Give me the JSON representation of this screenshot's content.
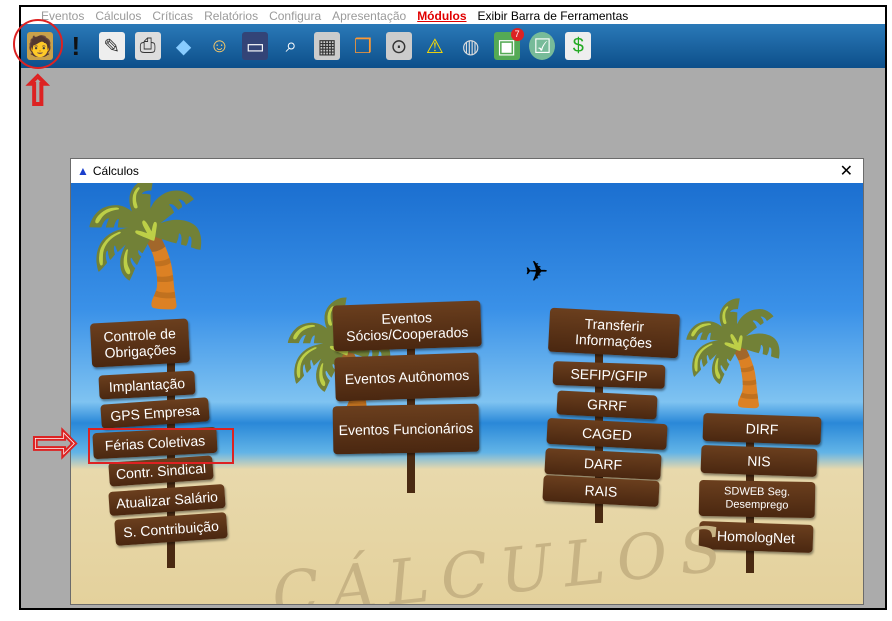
{
  "menu": {
    "items": [
      "Eventos",
      "Cálculos",
      "Críticas",
      "Relatórios",
      "Configura",
      "Apresentação"
    ],
    "active": "Módulos",
    "extra": "Exibir Barra de Ferramentas"
  },
  "toolbar": {
    "icons": [
      "person-desk-icon",
      "exclamation-icon",
      "pen-icon",
      "printer-icon",
      "paint-bucket-icon",
      "users-key-icon",
      "monitor-icon",
      "magnifier-icon",
      "calculator-icon",
      "book-icon",
      "search-doc-icon",
      "warning-icon",
      "database-icon",
      "calendar-icon",
      "checklist-icon",
      "money-doc-icon"
    ],
    "badge": "7"
  },
  "window": {
    "title": "Cálculos",
    "close": "✕"
  },
  "signs_left": [
    "Controle de Obrigações",
    "Implantação",
    "GPS Empresa",
    "Férias Coletivas",
    "Contr. Sindical",
    "Atualizar Salário",
    "S. Contribuição"
  ],
  "signs_center": [
    "Eventos Sócios/Cooperados",
    "Eventos Autônomos",
    "Eventos Funcionários"
  ],
  "signs_right1": [
    "Transferir Informações",
    "SEFIP/GFIP",
    "GRRF",
    "CAGED",
    "DARF",
    "RAIS"
  ],
  "signs_right2": [
    "DIRF",
    "NIS",
    "SDWEB Seg. Desemprego",
    "HomologNet"
  ],
  "sand_text": "CÁLCULOS"
}
